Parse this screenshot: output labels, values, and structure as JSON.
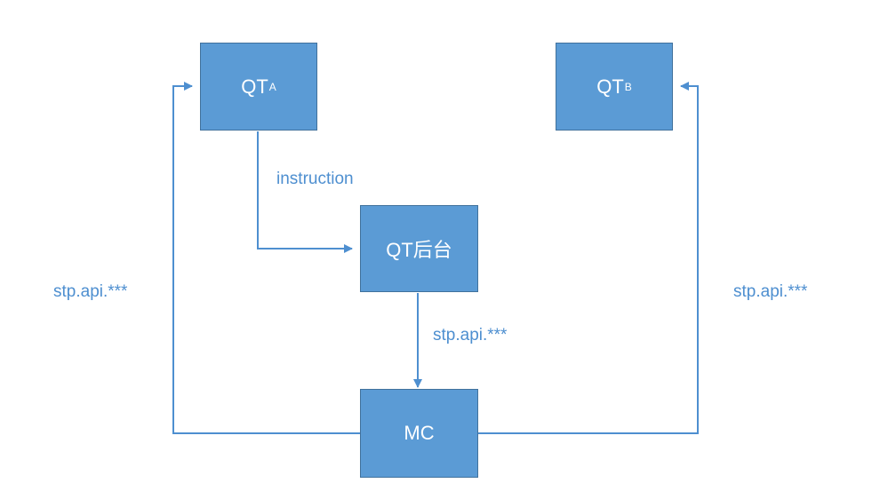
{
  "diagram": {
    "nodes": {
      "qt_a": {
        "label": "QT",
        "subscript": "A"
      },
      "qt_b": {
        "label": "QT",
        "subscript": "B"
      },
      "qt_backend": {
        "label": "QT后台"
      },
      "mc": {
        "label": "MC"
      }
    },
    "edges": {
      "qt_a_to_backend": {
        "label": "instruction"
      },
      "backend_to_mc": {
        "label": "stp.api.***"
      },
      "mc_to_qt_a": {
        "label": "stp.api.***"
      },
      "mc_to_qt_b": {
        "label": "stp.api.***"
      }
    }
  },
  "colors": {
    "node_fill": "#5b9bd5",
    "node_border": "#41719c",
    "connector": "#4e8fd0",
    "label_text": "#4e8fd0",
    "node_text": "#ffffff"
  }
}
